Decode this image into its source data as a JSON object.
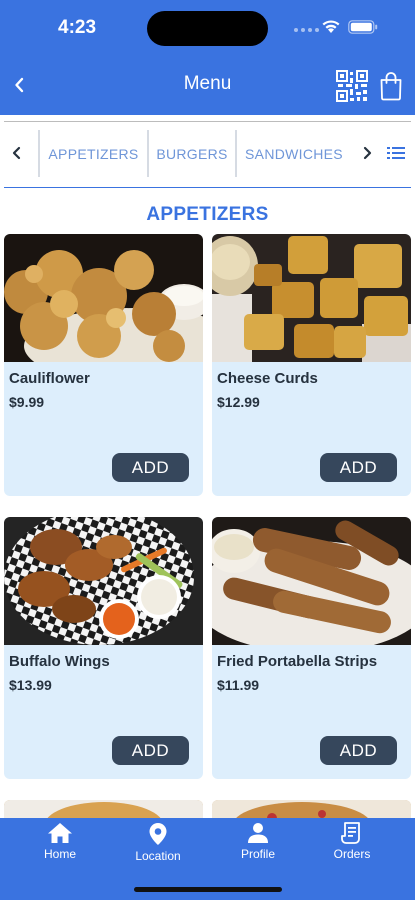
{
  "status_bar": {
    "time": "4:23"
  },
  "header": {
    "title": "Menu"
  },
  "categories": {
    "tabs": [
      {
        "label": "APPETIZERS"
      },
      {
        "label": "BURGERS"
      },
      {
        "label": "SANDWICHES"
      }
    ]
  },
  "section": {
    "title": "APPETIZERS"
  },
  "items": [
    {
      "name": "Cauliflower",
      "price": "$9.99",
      "add_label": "ADD"
    },
    {
      "name": "Cheese Curds",
      "price": "$12.99",
      "add_label": "ADD"
    },
    {
      "name": "Buffalo Wings",
      "price": "$13.99",
      "add_label": "ADD"
    },
    {
      "name": "Fried Portabella Strips",
      "price": "$11.99",
      "add_label": "ADD"
    }
  ],
  "tabbar": {
    "home": "Home",
    "location": "Location",
    "profile": "Profile",
    "orders": "Orders"
  },
  "colors": {
    "primary": "#3a73e0",
    "card_bg": "#ddeefc",
    "button": "#36475c",
    "tab_text": "#6f96d8"
  },
  "icons": [
    "chevron-left-icon",
    "qr-code-icon",
    "shopping-bag-icon",
    "chevron-right-icon",
    "list-icon",
    "home-icon",
    "location-pin-icon",
    "person-icon",
    "receipt-icon",
    "wifi-icon",
    "battery-icon"
  ]
}
